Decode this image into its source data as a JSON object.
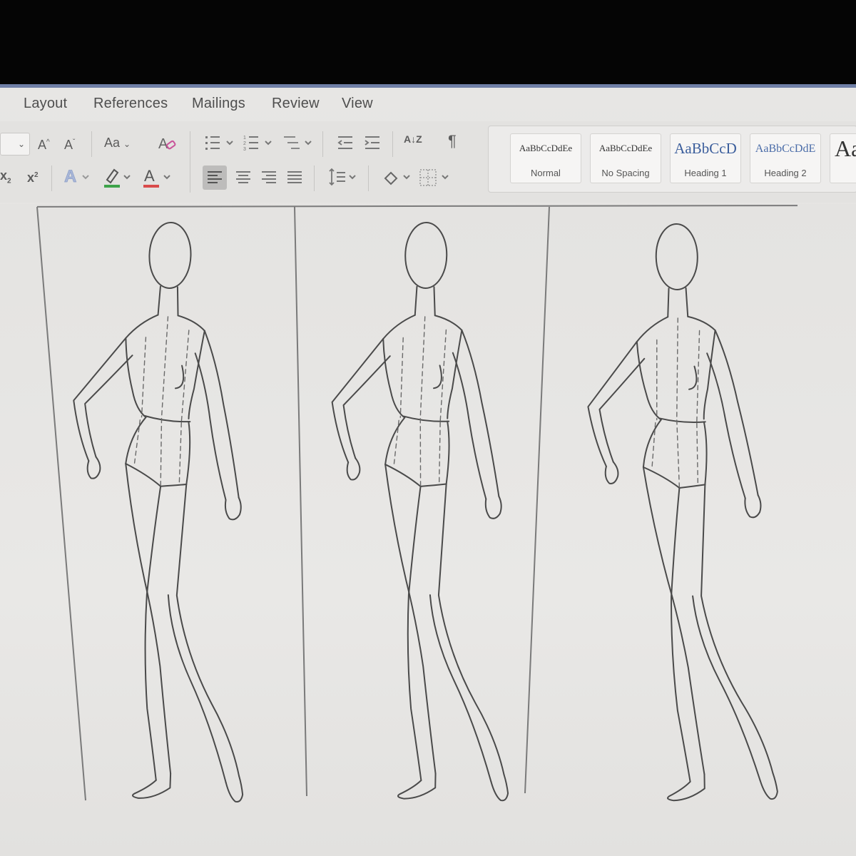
{
  "ribbon": {
    "tabs": [
      "Layout",
      "References",
      "Mailings",
      "Review",
      "View"
    ],
    "font_grow": "A",
    "font_shrink": "A",
    "change_case": "Aa",
    "subscript": "x",
    "superscript": "x",
    "pilcrow": "¶",
    "sort": "A↓Z",
    "font_color_accent": "#d94b4b",
    "highlight_accent": "#3ea34a"
  },
  "styles": [
    {
      "sample": "AaBbCcDdEe",
      "name": "Normal"
    },
    {
      "sample": "AaBbCcDdEe",
      "name": "No Spacing"
    },
    {
      "sample": "AaBbCcD",
      "name": "Heading 1"
    },
    {
      "sample": "AaBbCcDdE",
      "name": "Heading 2"
    },
    {
      "sample": "Aa",
      "name": ""
    }
  ],
  "document": {
    "figure_count": 3
  }
}
